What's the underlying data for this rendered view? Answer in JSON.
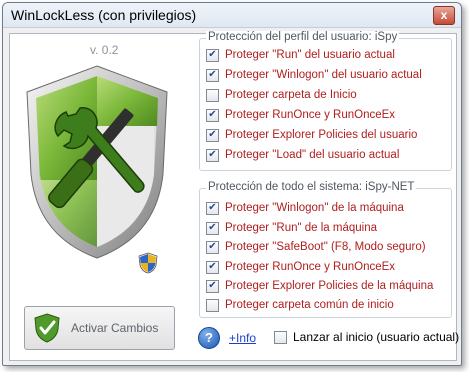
{
  "window": {
    "title": "WinLockLess (con privilegios)",
    "close_symbol": "x"
  },
  "app": {
    "version": "v. 0.2",
    "logo_icon": "shield-tools-icon",
    "uac_icon": "uac-shield-icon"
  },
  "user_group": {
    "title": "Protección del perfil del usuario: iSpy",
    "items": [
      {
        "label": "Proteger \"Run\" del usuario actual",
        "checked": true
      },
      {
        "label": "Proteger \"Winlogon\" del usuario actual",
        "checked": true
      },
      {
        "label": "Proteger carpeta de Inicio",
        "checked": false
      },
      {
        "label": "Proteger RunOnce y RunOnceEx",
        "checked": true
      },
      {
        "label": "Proteger Explorer Policies del usuario",
        "checked": true
      },
      {
        "label": "Proteger \"Load\" del usuario actual",
        "checked": true
      }
    ]
  },
  "system_group": {
    "title": "Protección de todo el sistema: iSpy-NET",
    "items": [
      {
        "label": "Proteger \"Winlogon\" de la máquina",
        "checked": true
      },
      {
        "label": "Proteger \"Run\" de la máquina",
        "checked": true
      },
      {
        "label": "Proteger \"SafeBoot\" (F8, Modo seguro)",
        "checked": true
      },
      {
        "label": "Proteger RunOnce y RunOnceEx",
        "checked": true
      },
      {
        "label": "Proteger Explorer Policies de la máquina",
        "checked": true
      },
      {
        "label": "Proteger carpeta común de inicio",
        "checked": false
      }
    ]
  },
  "actions": {
    "activate_label": "Activar Cambios",
    "help_symbol": "?",
    "info_link": "+Info",
    "startup_label": "Lanzar al inicio (usuario actual)",
    "startup_checked": false
  },
  "colors": {
    "item_text": "#b01e1e",
    "shield_green": "#6fae2e",
    "link": "#1a3fd0"
  }
}
